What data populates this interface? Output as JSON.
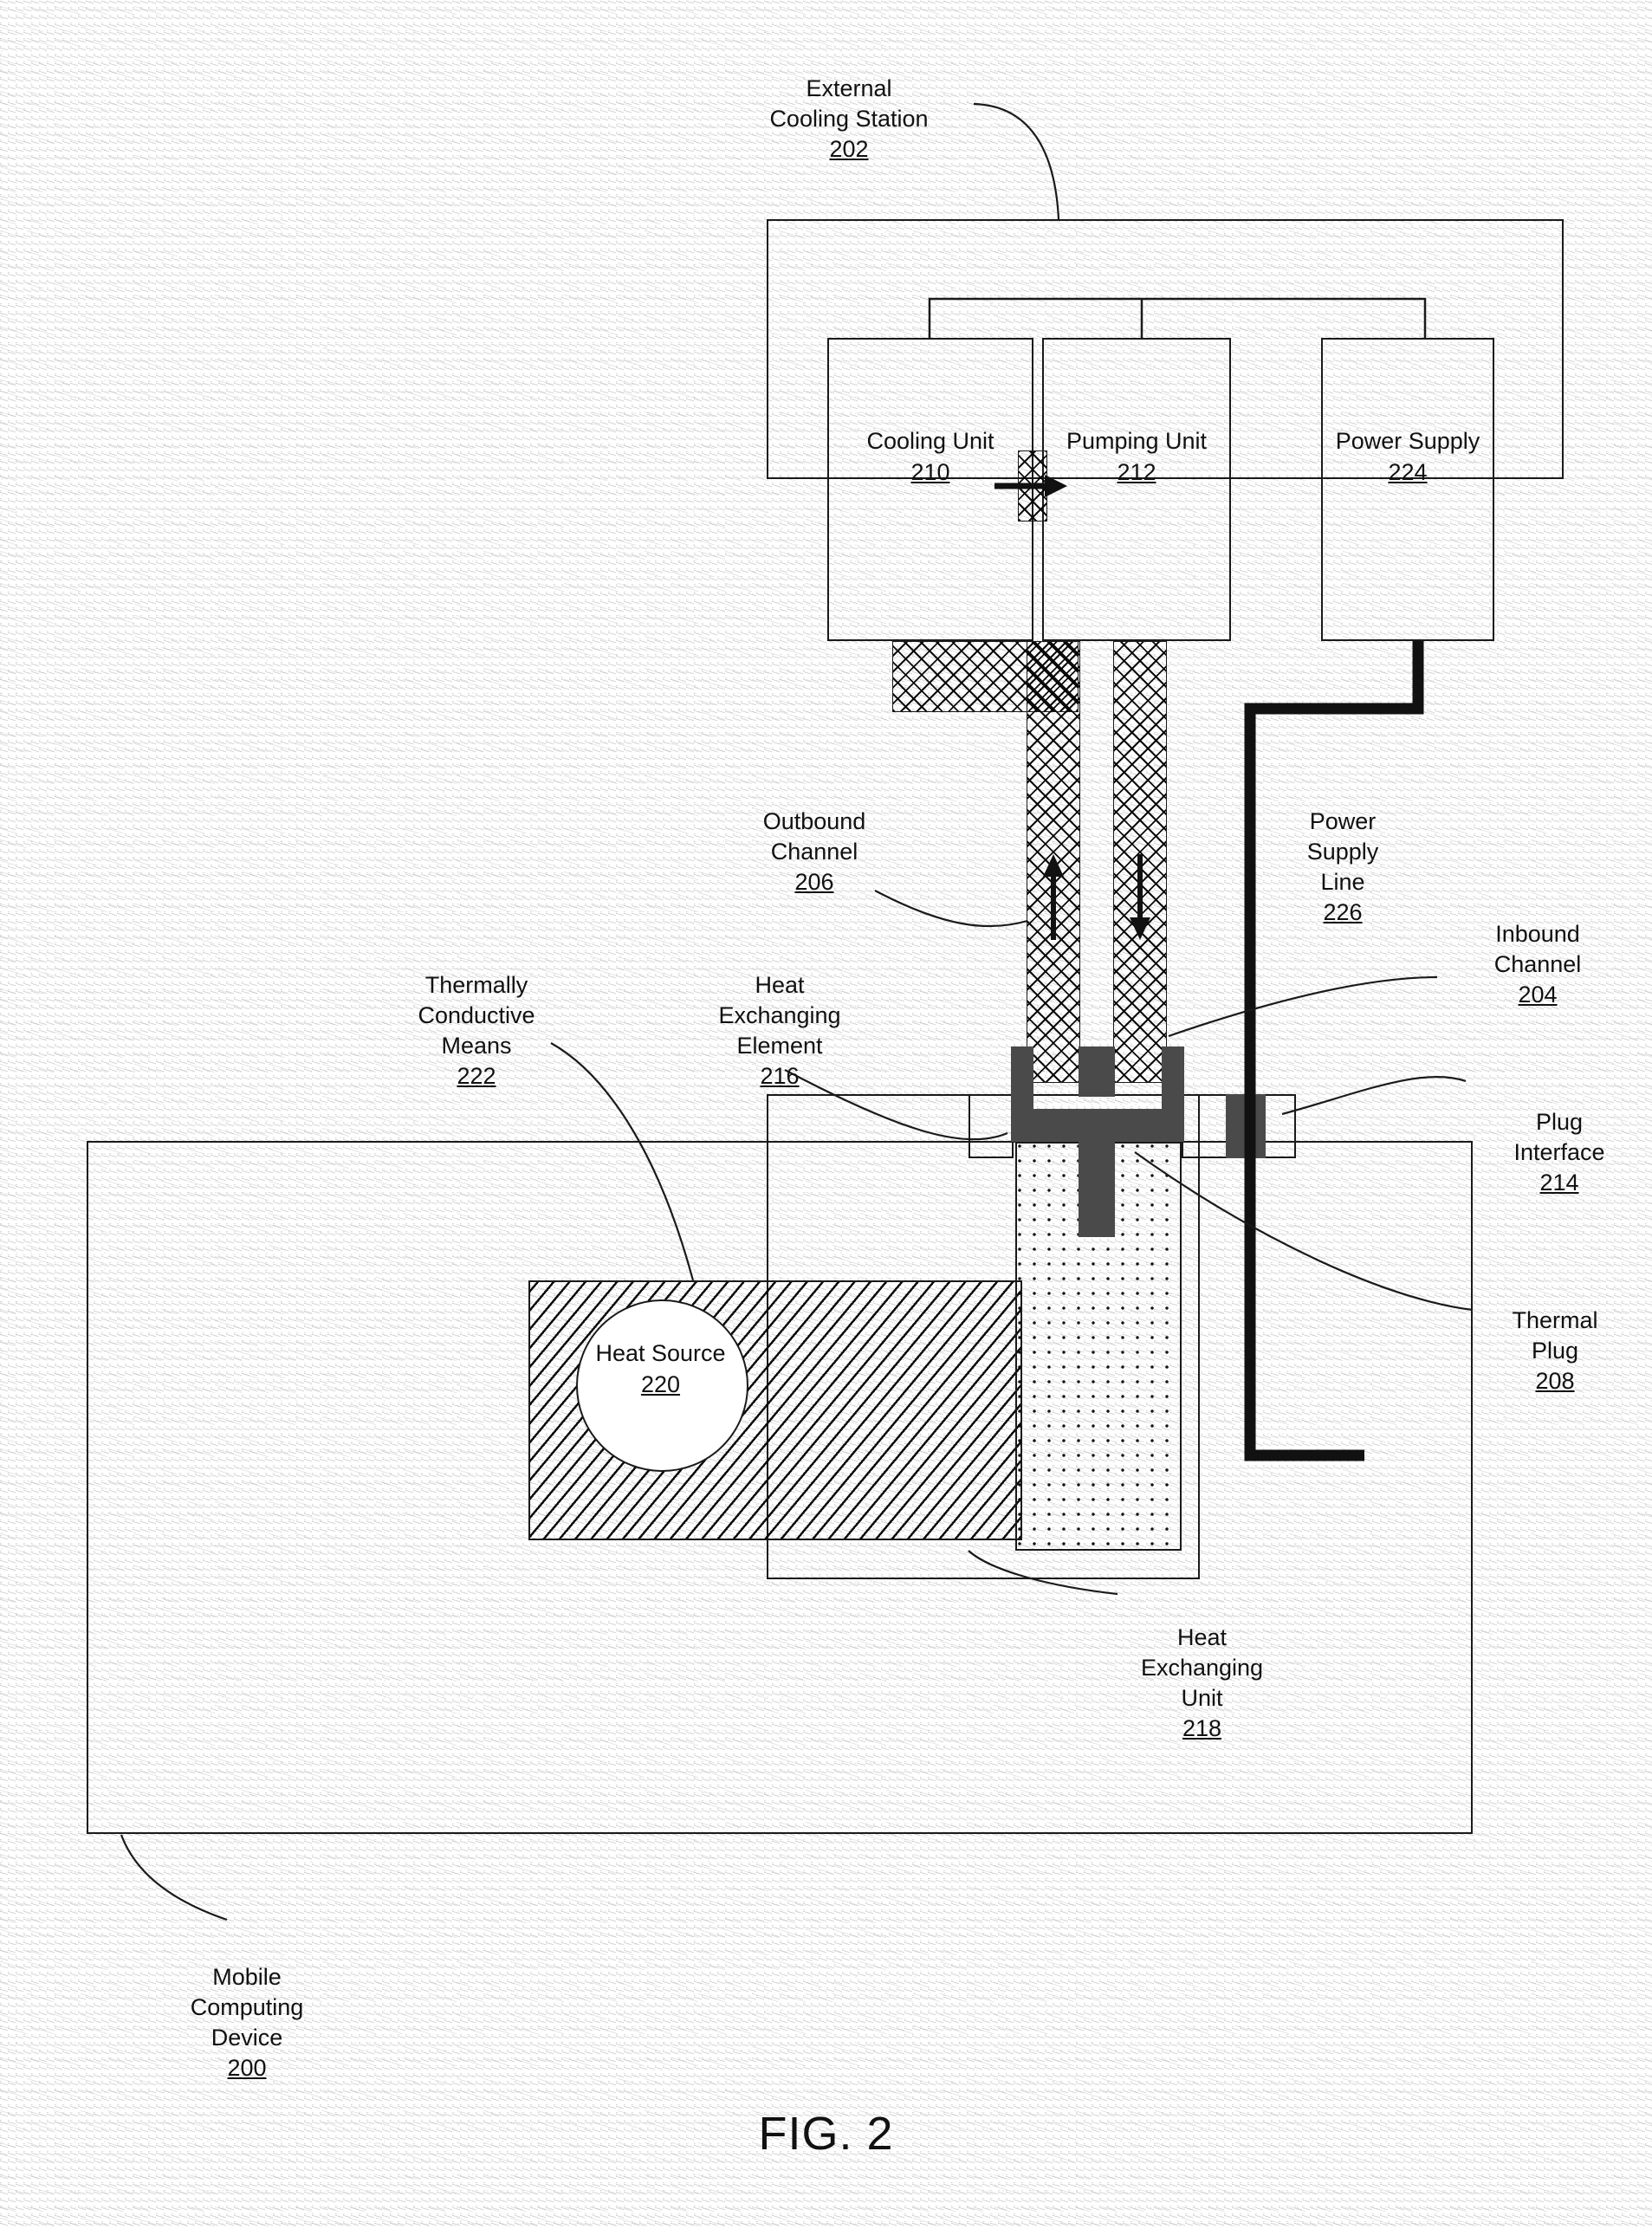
{
  "figure": {
    "caption": "FIG. 2"
  },
  "labels": {
    "external_cooling_station": {
      "text": "External\nCooling Station",
      "number": "202"
    },
    "outbound_channel": {
      "text": "Outbound\nChannel",
      "number": "206"
    },
    "inbound_channel": {
      "text": "Inbound\nChannel",
      "number": "204"
    },
    "power_supply_line": {
      "text": "Power\nSupply\nLine",
      "number": "226"
    },
    "thermally_conductive_means": {
      "text": "Thermally\nConductive\nMeans",
      "number": "222"
    },
    "heat_exchanging_element": {
      "text": "Heat\nExchanging\nElement",
      "number": "216"
    },
    "plug_interface": {
      "text": "Plug\nInterface",
      "number": "214"
    },
    "thermal_plug": {
      "text": "Thermal\nPlug",
      "number": "208"
    },
    "heat_exchanging_unit": {
      "text": "Heat\nExchanging\nUnit",
      "number": "218"
    },
    "mobile_computing_device": {
      "text": "Mobile\nComputing\nDevice",
      "number": "200"
    }
  },
  "blocks": {
    "cooling_unit": {
      "text": "Cooling\nUnit",
      "number": "210"
    },
    "pumping_unit": {
      "text": "Pumping\nUnit",
      "number": "212"
    },
    "power_supply": {
      "text": "Power\nSupply",
      "number": "224"
    },
    "heat_source": {
      "text": "Heat\nSource",
      "number": "220"
    }
  },
  "flow_arrows": {
    "outbound_direction": "up",
    "inbound_direction": "down",
    "cooling_to_pumping_direction": "right"
  },
  "colors": {
    "line": "#1a1a1a",
    "fill_solid": "#4a4a4a",
    "paper": "#ffffff"
  }
}
